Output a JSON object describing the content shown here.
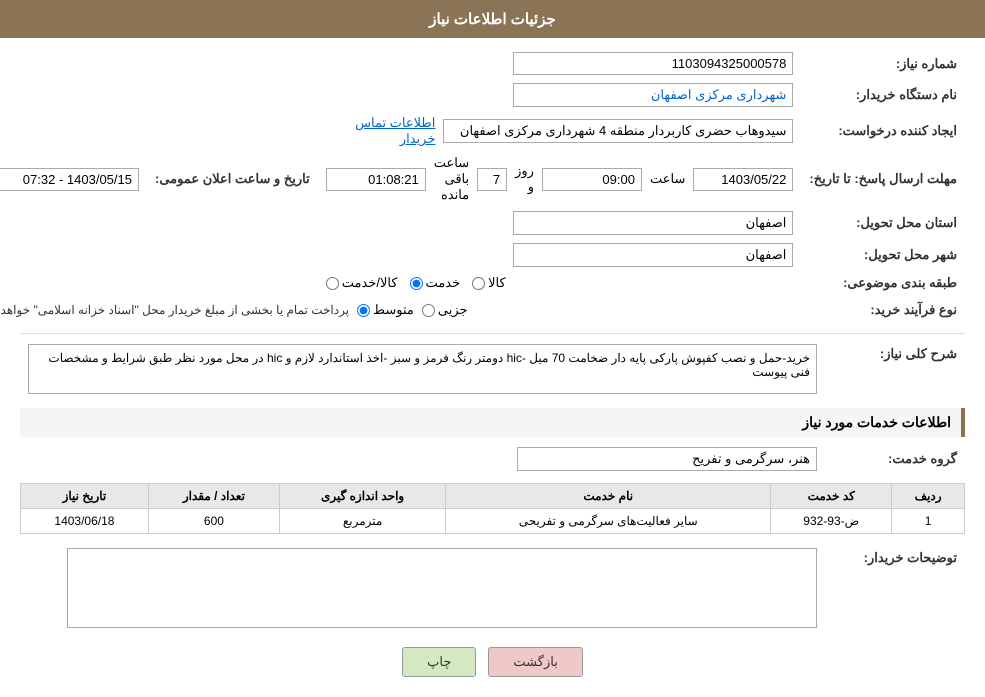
{
  "header": {
    "title": "جزئیات اطلاعات نیاز"
  },
  "fields": {
    "shomara_niaz_label": "شماره نیاز:",
    "shomara_niaz_value": "1103094325000578",
    "nam_dastgah_label": "نام دستگاه خریدار:",
    "nam_dastgah_value": "شهرداری مرکزی اصفهان",
    "ijad_konande_label": "ایجاد کننده درخواست:",
    "ijad_konande_value": "سیدوهاب حضری کاربردار منطقه 4 شهرداری مرکزی اصفهان",
    "ijad_konande_link": "اطلاعات تماس خریدار",
    "mohlet_label": "مهلت ارسال پاسخ: تا تاریخ:",
    "tarikh_value": "1403/05/22",
    "saat_label": "ساعت",
    "saat_value": "09:00",
    "roz_label": "روز و",
    "roz_value": "7",
    "baqi_mande_label": "ساعت باقی مانده",
    "baqi_mande_value": "01:08:21",
    "tarikh_elaan_label": "تاریخ و ساعت اعلان عمومی:",
    "tarikh_elaan_value": "1403/05/15 - 07:32",
    "ostan_tahvil_label": "استان محل تحویل:",
    "ostan_tahvil_value": "اصفهان",
    "shahr_tahvil_label": "شهر محل تحویل:",
    "shahr_tahvil_value": "اصفهان",
    "tabagheh_label": "طبقه بندی موضوعی:",
    "tabagheh_kala": "کالا",
    "tabagheh_khedmat": "خدمت",
    "tabagheh_kala_khedmat": "کالا/خدمت",
    "tabagheh_selected": "khedmat",
    "farayand_label": "نوع فرآیند خرید:",
    "farayand_jozii": "جزیی",
    "farayand_motavaset": "متوسط",
    "farayand_note": "پرداخت تمام یا بخشی از مبلغ خریدار محل \"اسناد خزانه اسلامی\" خواهد بود.",
    "sharh_niaz_label": "شرح کلی نیاز:",
    "sharh_niaz_value": "خرید-حمل و نصب کفپوش پارکی پایه دار ضخامت 70 میل -hic دومتر رنگ فرمز و سبز -اخذ استاندارد لازم و hic در محل مورد نظر طبق شرایط و مشخصات فنی پیوست",
    "khadamat_label": "اطلاعات خدمات مورد نیاز",
    "grouh_khedmat_label": "گروه خدمت:",
    "grouh_khedmat_value": "هنر، سرگرمی و تفریح",
    "table_headers": {
      "radif": "ردیف",
      "code_khedmat": "کد خدمت",
      "nam_khedmat": "نام خدمت",
      "vahed": "واحد اندازه گیری",
      "tedaad": "تعداد / مقدار",
      "tarikh_niaz": "تاریخ نیاز"
    },
    "table_rows": [
      {
        "radif": "1",
        "code_khedmat": "ض-93-932",
        "nam_khedmat": "سایر فعالیت‌های سرگرمی و تفریحی",
        "vahed": "مترمربع",
        "tedaad": "600",
        "tarikh_niaz": "1403/06/18"
      }
    ],
    "tosehat_label": "توضیحات خریدار:",
    "tosehat_value": "",
    "btn_back": "بازگشت",
    "btn_print": "چاپ"
  }
}
